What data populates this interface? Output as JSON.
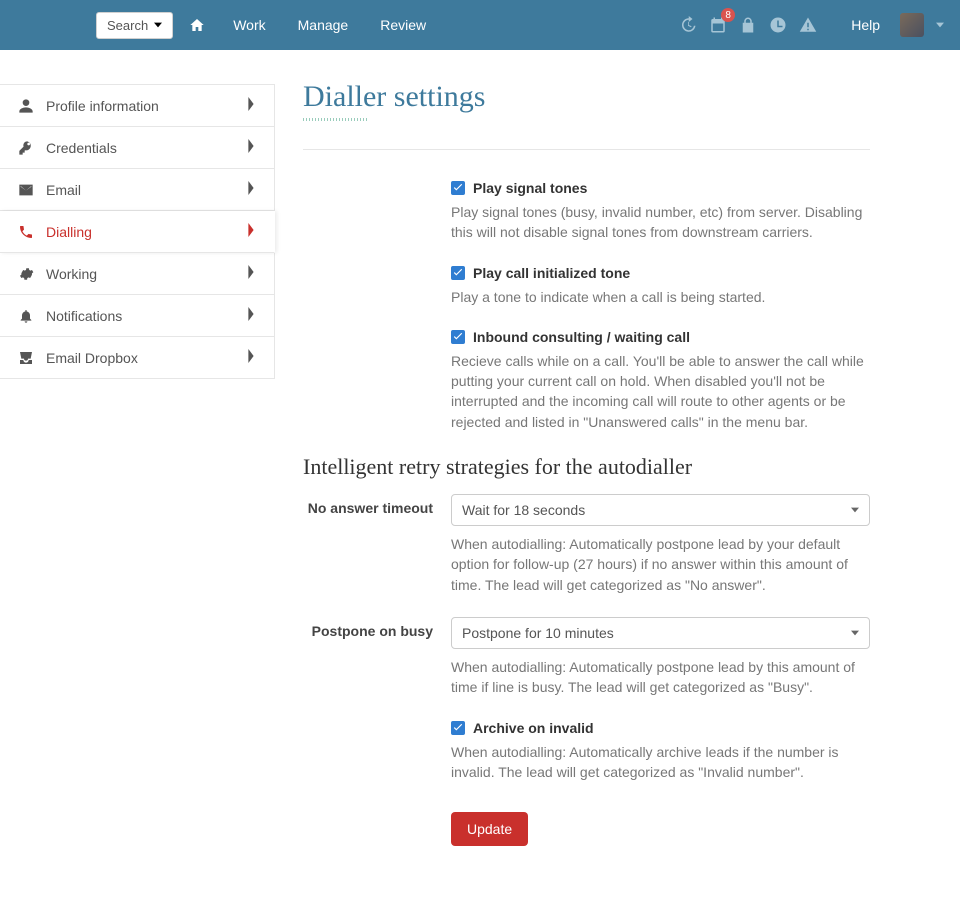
{
  "nav": {
    "search": "Search",
    "home_icon": "home-icon",
    "links": [
      "Work",
      "Manage",
      "Review"
    ],
    "help": "Help",
    "calendar_badge": "8"
  },
  "sidebar": [
    {
      "icon": "user",
      "label": "Profile information"
    },
    {
      "icon": "key",
      "label": "Credentials"
    },
    {
      "icon": "envelope",
      "label": "Email"
    },
    {
      "icon": "phone",
      "label": "Dialling",
      "active": true
    },
    {
      "icon": "cogs",
      "label": "Working"
    },
    {
      "icon": "bell",
      "label": "Notifications"
    },
    {
      "icon": "inbox",
      "label": "Email Dropbox"
    }
  ],
  "page": {
    "title": "Dialler settings",
    "checkboxes": [
      {
        "label": "Play signal tones",
        "help": "Play signal tones (busy, invalid number, etc) from server. Disabling this will not disable signal tones from downstream carriers."
      },
      {
        "label": "Play call initialized tone",
        "help": "Play a tone to indicate when a call is being started."
      },
      {
        "label": "Inbound consulting / waiting call",
        "help": "Recieve calls while on a call. You'll be able to answer the call while putting your current call on hold. When disabled you'll not be interrupted and the incoming call will route to other agents or be rejected and listed in \"Unanswered calls\" in the menu bar."
      }
    ],
    "section2_title": "Intelligent retry strategies for the autodialler",
    "no_answer": {
      "label": "No answer timeout",
      "value": "Wait for 18 seconds",
      "help": "When autodialling: Automatically postpone lead by your default option for follow-up (27 hours) if no answer within this amount of time. The lead will get categorized as \"No answer\"."
    },
    "postpone": {
      "label": "Postpone on busy",
      "value": "Postpone for 10 minutes",
      "help": "When autodialling: Automatically postpone lead by this amount of time if line is busy. The lead will get categorized as \"Busy\"."
    },
    "archive": {
      "label": "Archive on invalid",
      "help": "When autodialling: Automatically archive leads if the number is invalid. The lead will get categorized as \"Invalid number\"."
    },
    "update_btn": "Update"
  }
}
